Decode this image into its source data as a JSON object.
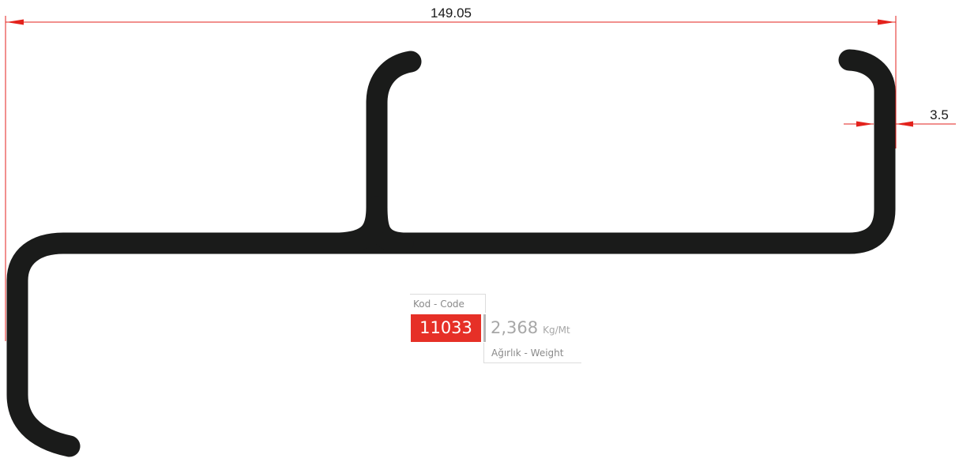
{
  "dimensions": {
    "overall_width": "149.05",
    "wall_thickness": "3.5"
  },
  "info": {
    "code_label": "Kod - Code",
    "code_value": "11033",
    "weight_value": "2,368",
    "weight_unit": "Kg/Mt",
    "weight_label": "Ağırlık - Weight"
  },
  "colors": {
    "profile": "#1a1b1a",
    "dimension": "#e3221c",
    "code_background": "#e63027"
  }
}
